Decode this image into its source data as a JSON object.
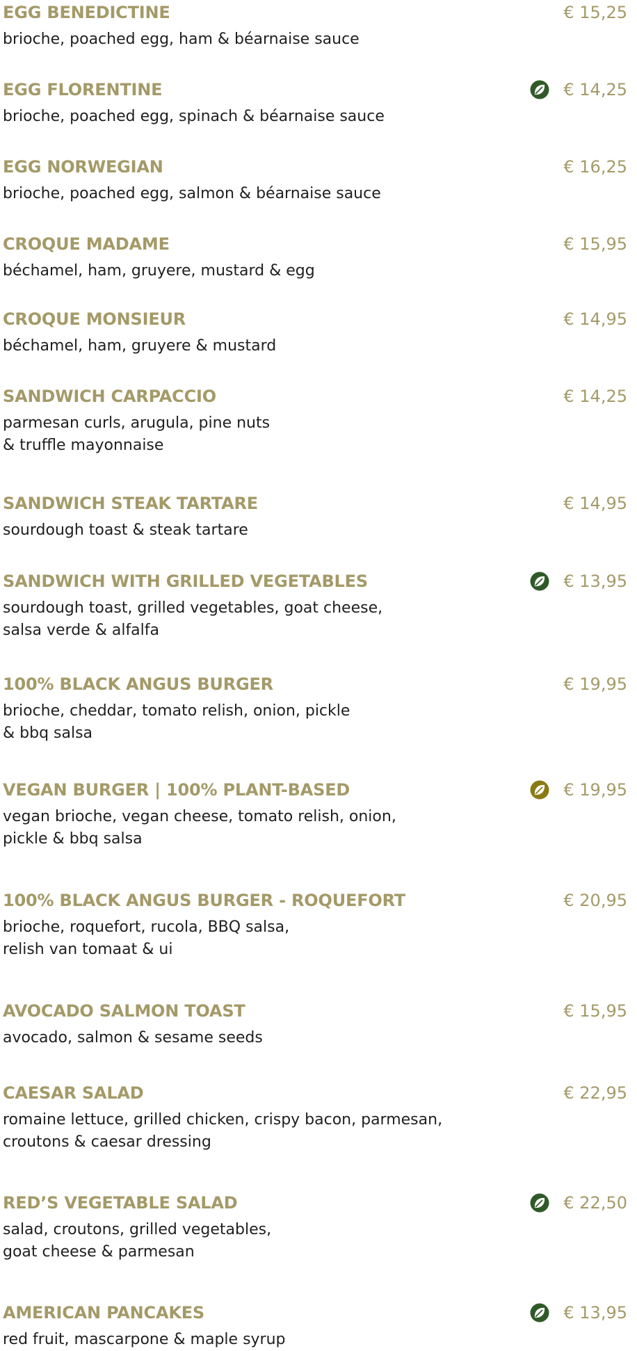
{
  "colors": {
    "heading": "#a49a68",
    "price": "#a49a68",
    "description": "#1f1f1f",
    "vegetarian_icon": "#2f5a28",
    "vegan_icon": "#8a7a14"
  },
  "items": [
    {
      "name": "EGG BENEDICTINE",
      "price": "€ 15,25",
      "description": "brioche, poached egg, ham & béarnaise sauce",
      "icon": null
    },
    {
      "name": "EGG FLORENTINE",
      "price": "€ 14,25",
      "description": "brioche, poached egg, spinach & béarnaise sauce",
      "icon": "vegetarian-leaf-icon"
    },
    {
      "name": "EGG NORWEGIAN",
      "price": "€ 16,25",
      "description": "brioche, poached egg, salmon & béarnaise sauce",
      "icon": null
    },
    {
      "name": "CROQUE MADAME",
      "price": "€ 15,95",
      "description": "béchamel, ham, gruyere, mustard & egg",
      "icon": null
    },
    {
      "name": "CROQUE MONSIEUR",
      "price": "€ 14,95",
      "description": "béchamel, ham, gruyere & mustard",
      "icon": null
    },
    {
      "name": "SANDWICH CARPACCIO",
      "price": "€ 14,25",
      "description": "parmesan curls, arugula, pine nuts\n& truffle mayonnaise",
      "icon": null
    },
    {
      "name": "SANDWICH STEAK TARTARE",
      "price": "€ 14,95",
      "description": "sourdough toast & steak tartare",
      "icon": null
    },
    {
      "name": "SANDWICH WITH GRILLED VEGETABLES",
      "price": "€ 13,95",
      "description": "sourdough toast, grilled vegetables, goat cheese,\nsalsa verde & alfalfa",
      "icon": "vegetarian-leaf-icon"
    },
    {
      "name": "100% BLACK ANGUS BURGER",
      "price": "€ 19,95",
      "description": "brioche, cheddar, tomato relish, onion, pickle\n& bbq salsa",
      "icon": null
    },
    {
      "name": "VEGAN BURGER | 100% PLANT-BASED",
      "price": "€ 19,95",
      "description": "vegan brioche, vegan cheese, tomato relish, onion,\npickle & bbq salsa",
      "icon": "vegan-leaf-icon"
    },
    {
      "name": "100% BLACK ANGUS BURGER - ROQUEFORT",
      "price": "€ 20,95",
      "description": "brioche, roquefort, rucola, BBQ salsa,\nrelish van tomaat & ui",
      "icon": null
    },
    {
      "name": "AVOCADO SALMON TOAST",
      "price": "€ 15,95",
      "description": "avocado, salmon & sesame seeds",
      "icon": null
    },
    {
      "name": "CAESAR SALAD",
      "price": "€ 22,95",
      "description": "romaine lettuce, grilled chicken, crispy bacon, parmesan,\ncroutons & caesar dressing",
      "icon": null
    },
    {
      "name": "RED’S VEGETABLE SALAD",
      "price": "€ 22,50",
      "description": "salad, croutons, grilled vegetables,\ngoat cheese & parmesan",
      "icon": "vegetarian-leaf-icon"
    },
    {
      "name": "AMERICAN PANCAKES",
      "price": "€ 13,95",
      "description": "red fruit, mascarpone & maple syrup",
      "icon": "vegetarian-leaf-icon"
    }
  ]
}
